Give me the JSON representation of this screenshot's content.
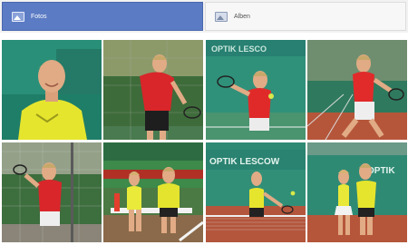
{
  "tabs": {
    "photos_label": "Fotos",
    "albums_label": "Alben"
  },
  "photos": [
    {
      "row": 1,
      "col": 1,
      "shirt": "yellow"
    },
    {
      "row": 1,
      "col": 2,
      "shirt": "red"
    },
    {
      "row": 1,
      "col": 3,
      "shirt": "red",
      "sign_text": "OPTIK LESCO"
    },
    {
      "row": 1,
      "col": 4,
      "shirt": "red"
    },
    {
      "row": 2,
      "col": 1,
      "shirt": "red"
    },
    {
      "row": 2,
      "col": 2,
      "shirt": "yellow"
    },
    {
      "row": 2,
      "col": 3,
      "shirt": "yellow",
      "sign_text": "OPTIK LESCOW"
    },
    {
      "row": 2,
      "col": 4,
      "shirt": "yellow",
      "sign_text": "OPTIK"
    }
  ],
  "colors": {
    "active_tab": "#5b7bc4",
    "inactive_tab": "#f7f7f7",
    "court_green": "#2e8c73",
    "clay": "#b5563a"
  }
}
